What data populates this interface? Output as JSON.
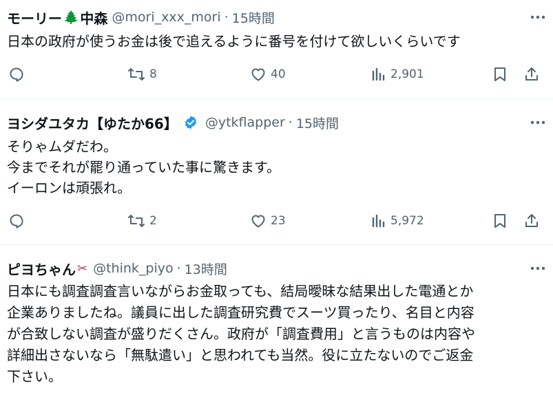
{
  "tweets": [
    {
      "name": "モーリー",
      "name_emoji": "🌲",
      "name_suffix": "中森",
      "handle": "@mori_xxx_mori",
      "dot": "·",
      "time": "15時間",
      "lines": [
        "日本の政府が使うお金は後で追えるように番号を付けて欲しいくらいです"
      ],
      "retweets": "8",
      "likes": "40",
      "views": "2,901"
    },
    {
      "name": "ヨシダユタカ【ゆたか66】",
      "verified": true,
      "handle": "@ytkflapper",
      "dot": "·",
      "time": "15時間",
      "lines": [
        "そりゃムダだわ。",
        "今までそれが罷り通っていた事に驚きます。",
        "イーロンは頑張れ。"
      ],
      "retweets": "2",
      "likes": "23",
      "views": "5,972"
    },
    {
      "name": "ピヨちゃん",
      "name_emoji": "✂",
      "handle": "@think_piyo",
      "dot": "·",
      "time": "13時間",
      "lines": [
        "日本にも調査調査言いながらお金取っても、結局曖昧な結果出した電通とか",
        "企業ありましたね。議員に出した調査研究費でスーツ買ったり、名目と内容",
        "が合致しない調査が盛りだくさん。政府が「調査費用」と言うものは内容や",
        "詳細出さないなら「無駄遣い」と思われても当然。役に立たないのでご返金",
        "下さい。"
      ]
    }
  ],
  "colors": {
    "text": "#0f1419",
    "secondary": "#536471",
    "verified": "#1d9bf0",
    "divider": "#eff3f4"
  }
}
